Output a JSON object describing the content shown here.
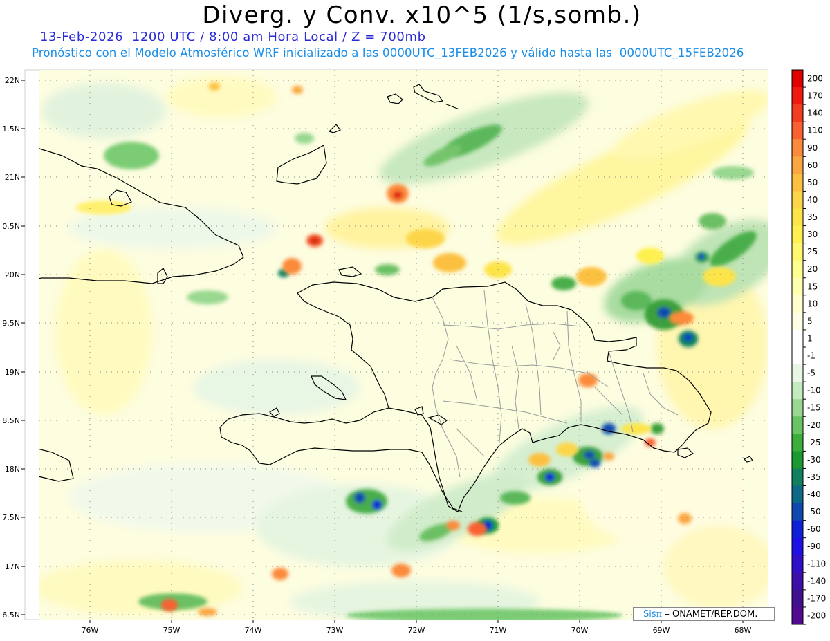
{
  "header": {
    "title": "Diverg. y Conv. x10^5 (1/s,somb.)",
    "subtitle_time": "13-Feb-2026  1200 UTC / 8:00 am Hora Local / Z = 700mb",
    "subtitle_model": "Pronóstico con el Modelo Atmosférico WRF inicializado a las 0000UTC_13FEB2026 y válido hasta las  0000UTC_15FEB2026"
  },
  "axes": {
    "lat_labels": [
      "22N",
      "1.5N",
      "21N",
      "0.5N",
      "20N",
      "9.5N",
      "19N",
      "8.5N",
      "18N",
      "7.5N",
      "17N",
      "6.5N"
    ],
    "lon_labels": [
      "76W",
      "75W",
      "74W",
      "73W",
      "72W",
      "71W",
      "70W",
      "69W",
      "68W"
    ]
  },
  "colorbar": {
    "labels": [
      "200",
      "170",
      "140",
      "110",
      "90",
      "60",
      "50",
      "40",
      "35",
      "30",
      "25",
      "20",
      "15",
      "10",
      "5",
      "1",
      "-1",
      "-5",
      "-10",
      "-15",
      "-20",
      "-25",
      "-30",
      "-35",
      "-40",
      "-50",
      "-60",
      "-90",
      "-110",
      "-140",
      "-170",
      "-200"
    ],
    "colors": [
      "#e00000",
      "#f01a10",
      "#f53e20",
      "#fa6030",
      "#fb8a3a",
      "#fba640",
      "#fcc040",
      "#fdd548",
      "#fde448",
      "#fef050",
      "#fff870",
      "#ffff90",
      "#ffffb0",
      "#ffffcc",
      "#ffffe6",
      "#ffffff",
      "#ffffff",
      "#e8f6e4",
      "#c4eac0",
      "#98d890",
      "#6ac464",
      "#3cae3c",
      "#1a9a30",
      "#108060",
      "#0c6a88",
      "#1048b0",
      "#1020d8",
      "#2010e8",
      "#3010c8",
      "#3c10a8",
      "#40108e",
      "#500a90"
    ]
  },
  "credit": {
    "logo": "Sis",
    "pi": "π",
    "org": "– ONAMET/REP.DOM."
  }
}
